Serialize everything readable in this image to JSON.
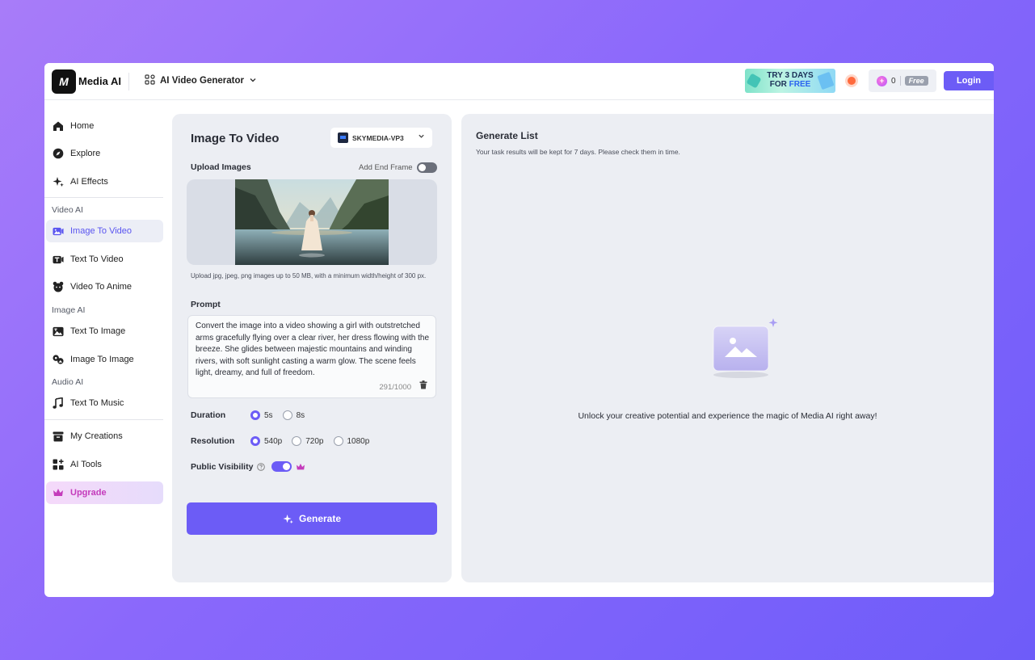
{
  "header": {
    "logo_mark": "M",
    "app_name": "Media AI",
    "menu_label": "AI Video Generator",
    "promo": {
      "line1": "TRY 3 DAYS",
      "line2_prefix": "FOR",
      "line2_free": "FREE"
    },
    "credits_count": "0",
    "plan_badge": "Free",
    "login_label": "Login"
  },
  "sidebar": {
    "home": "Home",
    "explore": "Explore",
    "ai_effects": "AI Effects",
    "section_video": "Video AI",
    "image_to_video": "Image To Video",
    "text_to_video": "Text To Video",
    "video_to_anime": "Video To Anime",
    "section_image": "Image AI",
    "text_to_image": "Text To Image",
    "image_to_image": "Image To Image",
    "section_audio": "Audio AI",
    "text_to_music": "Text To Music",
    "my_creations": "My Creations",
    "ai_tools": "AI Tools",
    "upgrade": "Upgrade",
    "active_item": "Image To Video"
  },
  "form": {
    "title": "Image To Video",
    "model": "SKYMEDIA-VP3",
    "upload_label": "Upload Images",
    "end_frame_label": "Add End Frame",
    "end_frame_enabled": false,
    "upload_hint": "Upload jpg, jpeg, png images up to 50 MB, with a minimum width/height of 300 px.",
    "prompt_label": "Prompt",
    "prompt_text": "Convert the image into a video showing a girl with outstretched arms gracefully flying over a clear river, her dress flowing with the breeze. She glides between majestic mountains and winding rivers, with soft sunlight casting a warm glow. The scene feels light, dreamy, and full of freedom.",
    "char_count": "291/1000",
    "duration_label": "Duration",
    "duration_options": [
      "5s",
      "8s"
    ],
    "duration_selected": "5s",
    "resolution_label": "Resolution",
    "resolution_options": [
      "540p",
      "720p",
      "1080p"
    ],
    "resolution_selected": "540p",
    "visibility_label": "Public Visibility",
    "visibility_enabled": true,
    "generate_label": "Generate"
  },
  "generate_list": {
    "title": "Generate List",
    "subtitle": "Your task results will be kept for 7 days. Please check them in time.",
    "empty_message": "Unlock your creative potential and experience the magic of Media AI right away!"
  },
  "colors": {
    "accent": "#6c5cf6",
    "background_gradient_start": "#a87cf9",
    "background_gradient_end": "#6e5cf9",
    "upgrade_pink": "#c43bbb",
    "panel_bg": "#eceef3"
  }
}
